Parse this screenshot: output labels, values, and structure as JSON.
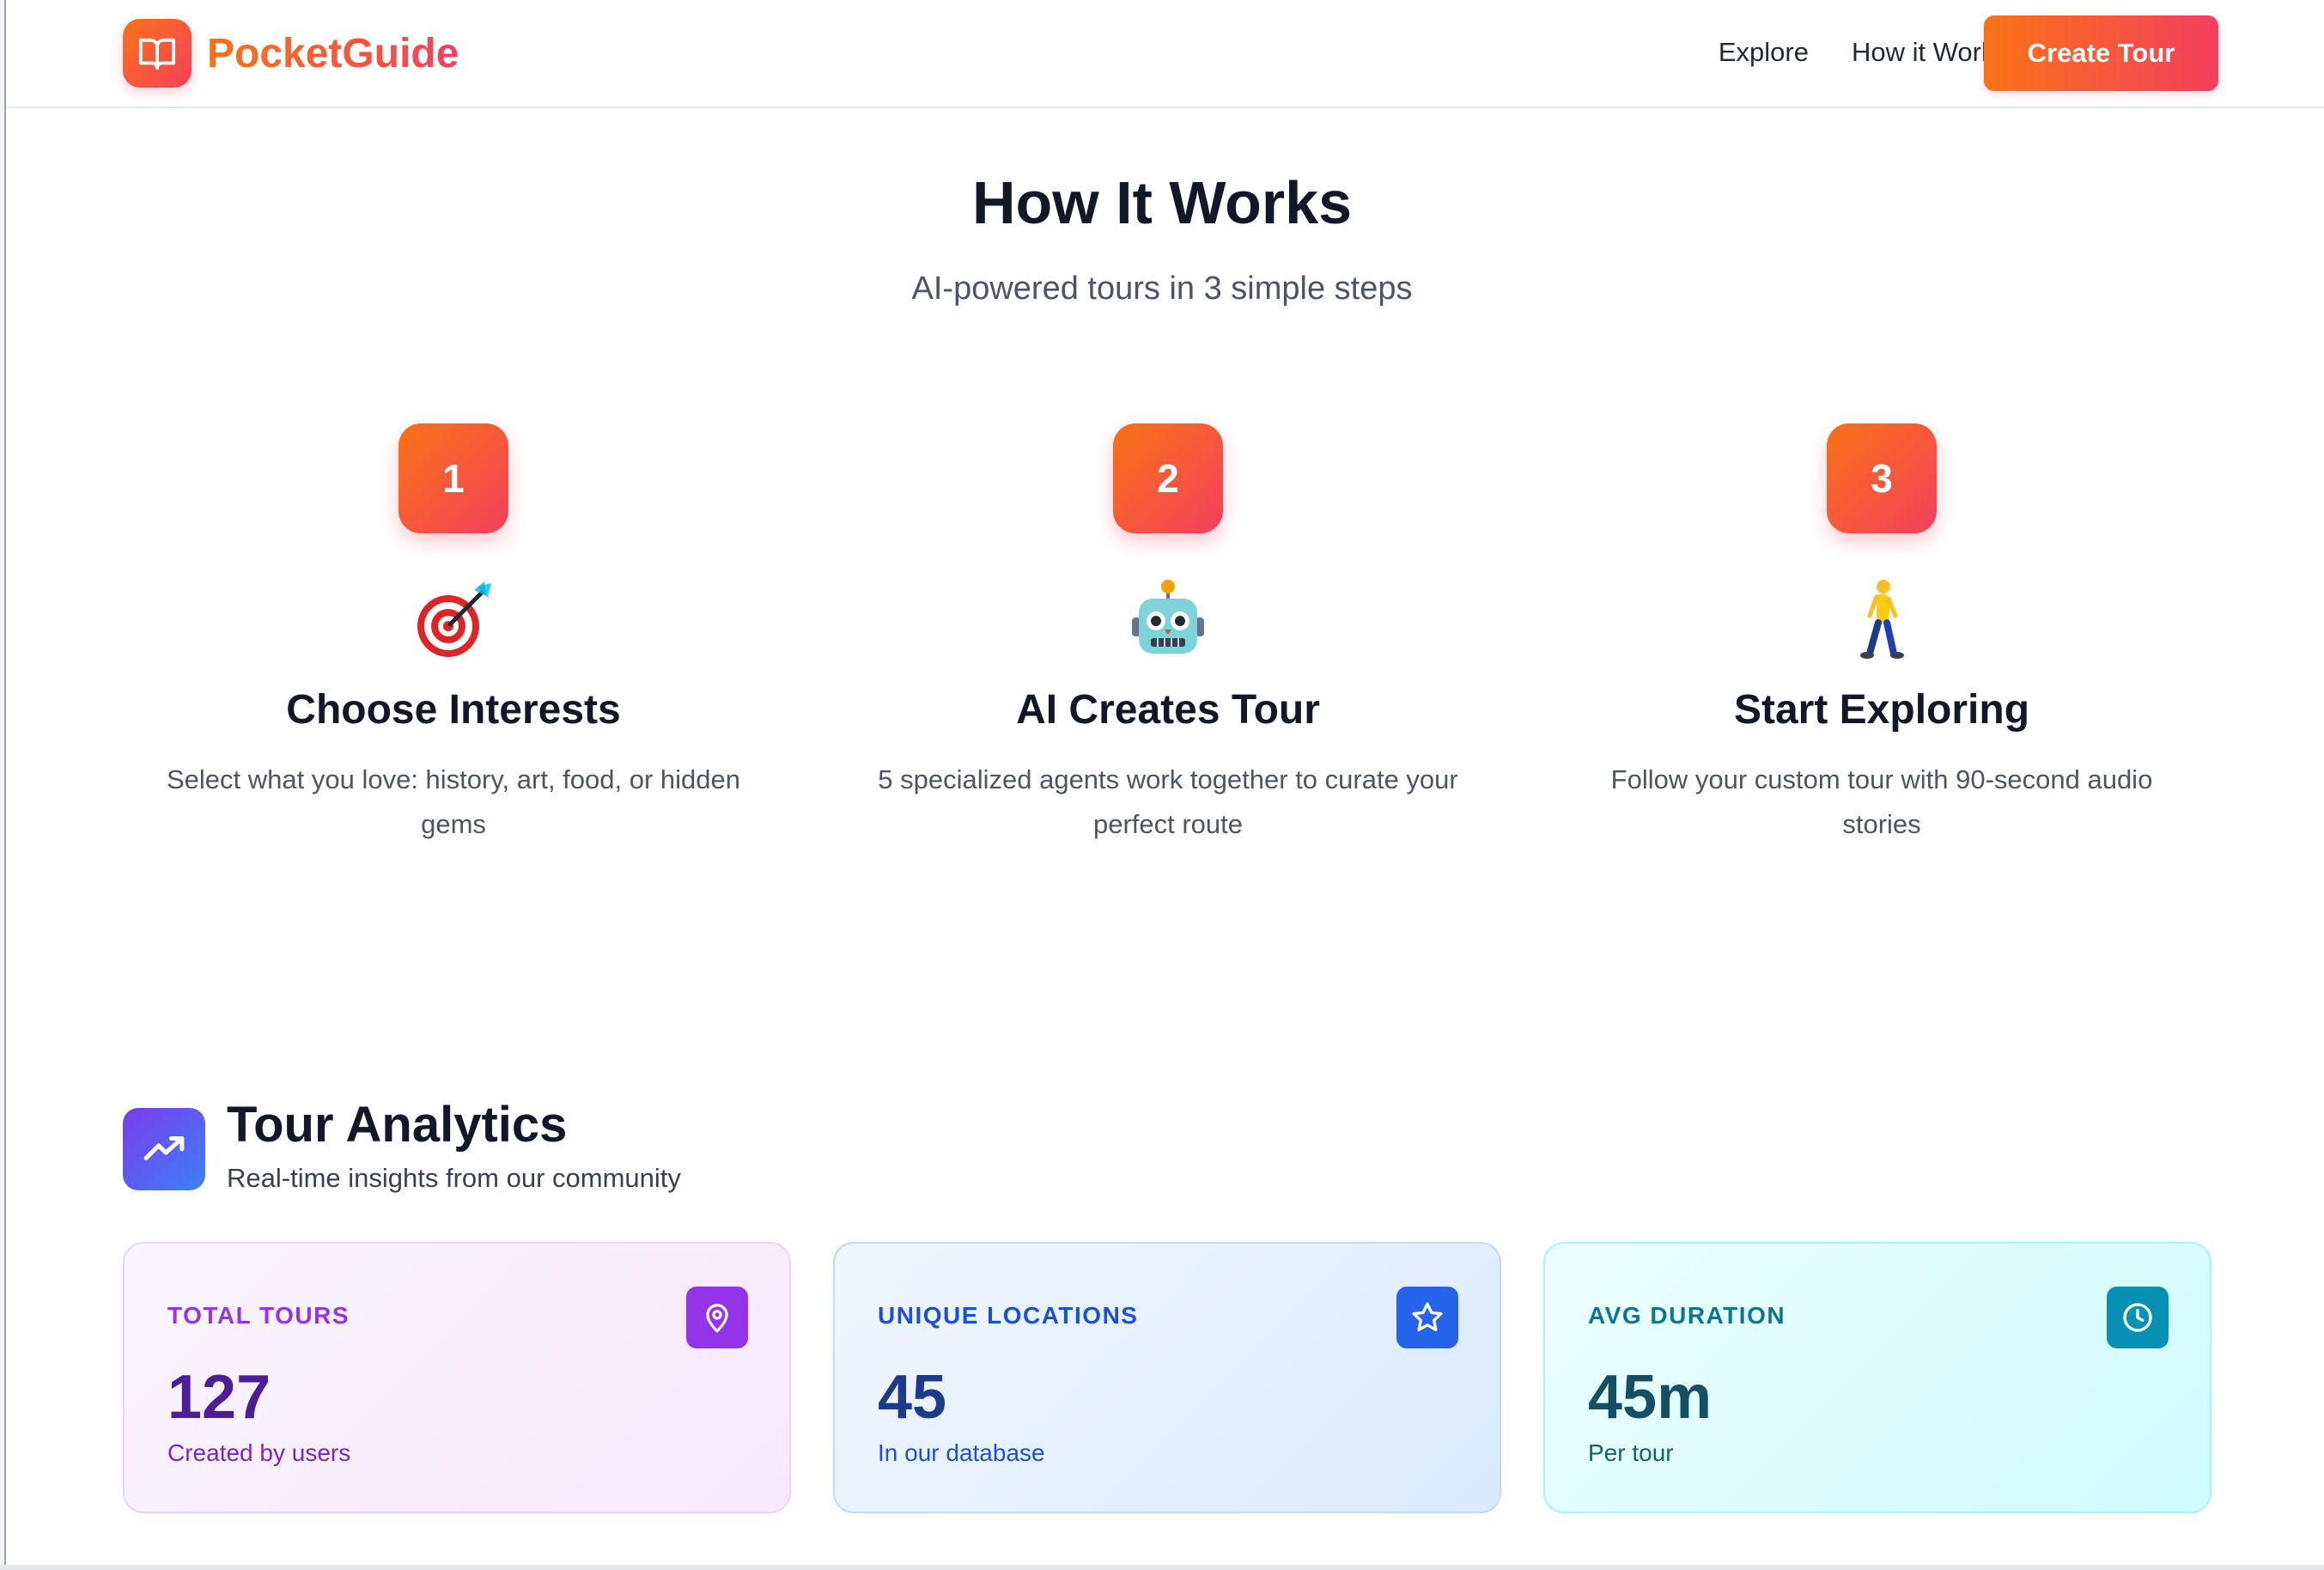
{
  "header": {
    "brand": "PocketGuide",
    "nav": [
      {
        "label": "Explore"
      },
      {
        "label": "How it Works"
      }
    ],
    "cta_label": "Create Tour"
  },
  "how_it_works": {
    "title": "How It Works",
    "subtitle": "AI-powered tours in 3 simple steps",
    "steps": [
      {
        "number": "1",
        "icon": "target-dart-icon",
        "title": "Choose Interests",
        "description": "Select what you love: history, art, food, or hidden gems"
      },
      {
        "number": "2",
        "icon": "robot-icon",
        "title": "AI Creates Tour",
        "description": "5 specialized agents work together to curate your perfect route"
      },
      {
        "number": "3",
        "icon": "walking-person-icon",
        "title": "Start Exploring",
        "description": "Follow your custom tour with 90-second audio stories"
      }
    ]
  },
  "analytics": {
    "icon": "trending-up-icon",
    "title": "Tour Analytics",
    "subtitle": "Real-time insights from our community",
    "cards": [
      {
        "label": "TOTAL TOURS",
        "value": "127",
        "note": "Created by users",
        "icon": "map-pin-icon",
        "accent": "#9333ea"
      },
      {
        "label": "UNIQUE LOCATIONS",
        "value": "45",
        "note": "In our database",
        "icon": "star-icon",
        "accent": "#2563eb"
      },
      {
        "label": "AVG DURATION",
        "value": "45m",
        "note": "Per tour",
        "icon": "clock-icon",
        "accent": "#0891b2"
      }
    ]
  },
  "colors": {
    "brand_gradient_start": "#f97316",
    "brand_gradient_end": "#f43f5e"
  }
}
